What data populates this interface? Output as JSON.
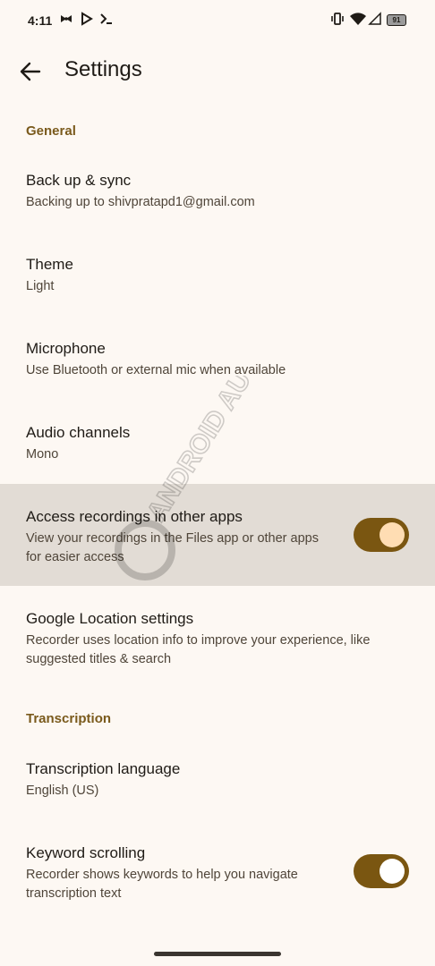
{
  "status_bar": {
    "time": "4:11",
    "battery": "91",
    "icons": [
      "fan-icon",
      "play-store-icon",
      "terminal-icon",
      "vibrate-icon",
      "wifi-icon",
      "signal-icon",
      "battery-icon"
    ]
  },
  "app_bar": {
    "title": "Settings",
    "back_icon": "arrow-back-icon"
  },
  "sections": {
    "general": "General",
    "transcription": "Transcription"
  },
  "items": {
    "backup": {
      "title": "Back up & sync",
      "subtitle": "Backing up to shivpratapd1@gmail.com"
    },
    "theme": {
      "title": "Theme",
      "subtitle": "Light"
    },
    "microphone": {
      "title": "Microphone",
      "subtitle": "Use Bluetooth or external mic when available"
    },
    "audio": {
      "title": "Audio channels",
      "subtitle": "Mono"
    },
    "access": {
      "title": "Access recordings in other apps",
      "subtitle": "View your recordings in the Files app or other apps for easier access",
      "enabled": true
    },
    "location": {
      "title": "Google Location settings",
      "subtitle": "Recorder uses location info to improve your experience, like suggested titles & search"
    },
    "language": {
      "title": "Transcription language",
      "subtitle": "English (US)"
    },
    "keyword": {
      "title": "Keyword scrolling",
      "subtitle": "Recorder shows keywords to help you navigate transcription text",
      "enabled": true
    }
  },
  "watermark": "ANDROID AUTHORITY",
  "colors": {
    "background": "#fdf8f3",
    "accent": "#7a5611",
    "section_header": "#7a5a1c",
    "highlight": "#e2dcd5"
  }
}
